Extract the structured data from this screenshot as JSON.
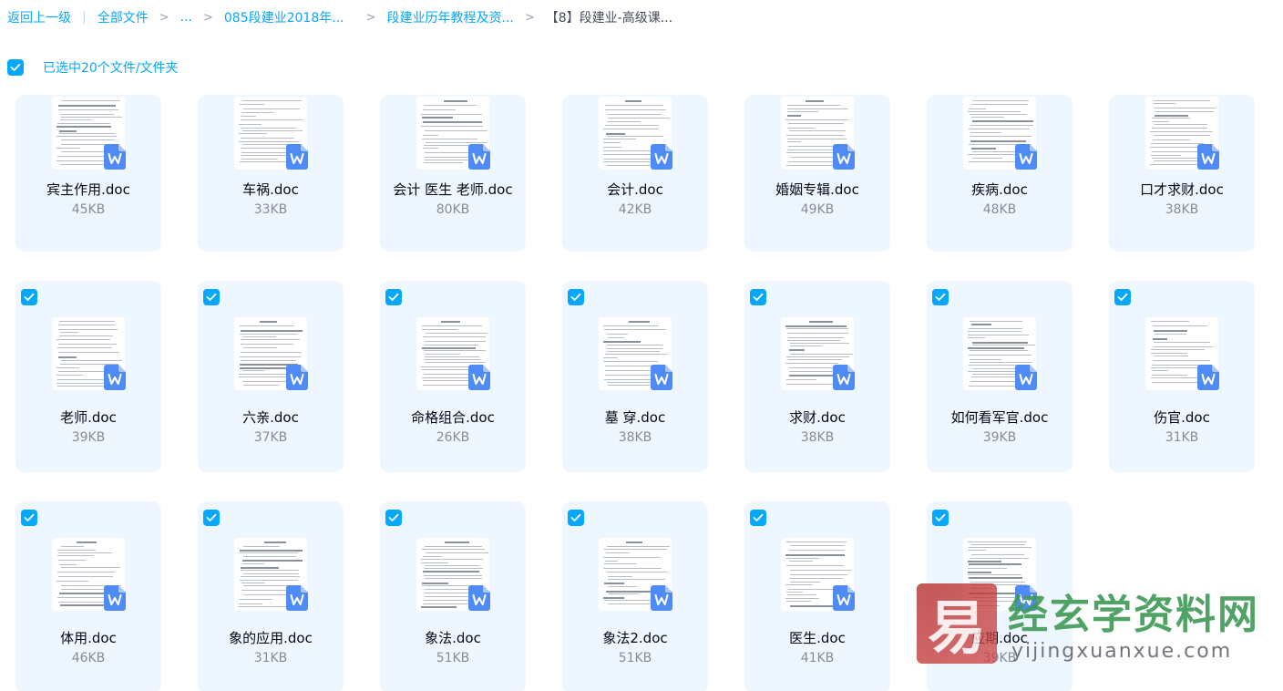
{
  "breadcrumb": {
    "back": "返回上一级",
    "all_files": "全部文件",
    "ellipsis": "...",
    "level1": "085段建业2018年...",
    "level2": "段建业历年教程及资...",
    "current": "【8】段建业-高级课..."
  },
  "selection": {
    "label": "已选中20个文件/文件夹",
    "checked": true
  },
  "files": [
    {
      "name": "宾主作用.doc",
      "size": "45KB",
      "checked": false
    },
    {
      "name": "车祸.doc",
      "size": "33KB",
      "checked": false
    },
    {
      "name": "会计 医生 老师.doc",
      "size": "80KB",
      "checked": false
    },
    {
      "name": "会计.doc",
      "size": "42KB",
      "checked": false
    },
    {
      "name": "婚姻专辑.doc",
      "size": "49KB",
      "checked": false
    },
    {
      "name": "疾病.doc",
      "size": "48KB",
      "checked": false
    },
    {
      "name": "口才求财.doc",
      "size": "38KB",
      "checked": false
    },
    {
      "name": "老师.doc",
      "size": "39KB",
      "checked": true
    },
    {
      "name": "六亲.doc",
      "size": "37KB",
      "checked": true
    },
    {
      "name": "命格组合.doc",
      "size": "26KB",
      "checked": true
    },
    {
      "name": "墓 穿.doc",
      "size": "38KB",
      "checked": true
    },
    {
      "name": "求财.doc",
      "size": "38KB",
      "checked": true
    },
    {
      "name": "如何看军官.doc",
      "size": "39KB",
      "checked": true
    },
    {
      "name": "伤官.doc",
      "size": "31KB",
      "checked": true
    },
    {
      "name": "体用.doc",
      "size": "46KB",
      "checked": true
    },
    {
      "name": "象的应用.doc",
      "size": "31KB",
      "checked": true
    },
    {
      "name": "象法.doc",
      "size": "51KB",
      "checked": true
    },
    {
      "name": "象法2.doc",
      "size": "51KB",
      "checked": true
    },
    {
      "name": "医生.doc",
      "size": "41KB",
      "checked": true
    },
    {
      "name": "应期.doc",
      "size": "39KB",
      "checked": true
    }
  ],
  "file_icon": "wps-word-icon",
  "colors": {
    "accent": "#06a7ff",
    "card_bg": "#eef7ff",
    "word_badge": "#4e8bf5"
  },
  "watermark": {
    "logo_char": "易",
    "title": "经玄学资料网",
    "url": "yijingxuanxue.com"
  }
}
